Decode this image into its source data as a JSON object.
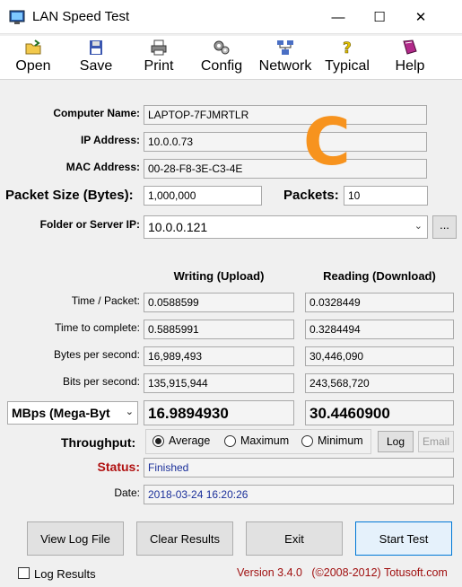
{
  "window": {
    "title": "LAN Speed Test",
    "minimize": "—",
    "maximize": "☐",
    "close": "✕"
  },
  "toolbar": [
    {
      "label": "Open",
      "icon": "open-folder-icon"
    },
    {
      "label": "Save",
      "icon": "floppy-disk-icon"
    },
    {
      "label": "Print",
      "icon": "printer-icon"
    },
    {
      "label": "Config",
      "icon": "config-gears-icon"
    },
    {
      "label": "Network",
      "icon": "network-icon"
    },
    {
      "label": "Typical",
      "icon": "help-lightbulb-icon"
    },
    {
      "label": "Help",
      "icon": "help-book-icon"
    }
  ],
  "info": {
    "computer_name_label": "Computer Name:",
    "computer_name": "LAPTOP-7FJMRTLR",
    "ip_label": "IP Address:",
    "ip": "10.0.0.73",
    "mac_label": "MAC Address:",
    "mac": "00-28-F8-3E-C3-4E",
    "packet_size_label": "Packet Size (Bytes):",
    "packet_size": "1,000,000",
    "packets_label": "Packets:",
    "packets": "10",
    "folder_label": "Folder or Server IP:",
    "folder": "10.0.0.121",
    "browse": "..."
  },
  "watermark": "C",
  "results": {
    "writing_header": "Writing (Upload)",
    "reading_header": "Reading (Download)",
    "rows": [
      {
        "label": "Time / Packet:",
        "write": "0.0588599",
        "read": "0.0328449"
      },
      {
        "label": "Time to complete:",
        "write": "0.5885991",
        "read": "0.3284494"
      },
      {
        "label": "Bytes per second:",
        "write": "16,989,493",
        "read": "30,446,090"
      },
      {
        "label": "Bits per second:",
        "write": "135,915,944",
        "read": "243,568,720"
      }
    ],
    "unit_select": "MBps (Mega-Byt",
    "write_big": "16.9894930",
    "read_big": "30.4460900"
  },
  "throughput": {
    "label": "Throughput:",
    "options": [
      "Average",
      "Maximum",
      "Minimum"
    ],
    "selected": "Average",
    "log_button": "Log",
    "email_button": "Email"
  },
  "status": {
    "label": "Status:",
    "value": "Finished",
    "date_label": "Date:",
    "date": "2018-03-24 16:20:26"
  },
  "buttons": {
    "view_log": "View Log File",
    "clear": "Clear Results",
    "exit": "Exit",
    "start": "Start Test"
  },
  "footer": {
    "log_results": "Log Results",
    "version": "Version 3.4.0   (©2008-2012) Totusoft.com"
  },
  "colors": {
    "status_label": "#b01010",
    "status_value": "#1a2f9a",
    "version": "#a01010",
    "watermark": "#f7931e"
  }
}
